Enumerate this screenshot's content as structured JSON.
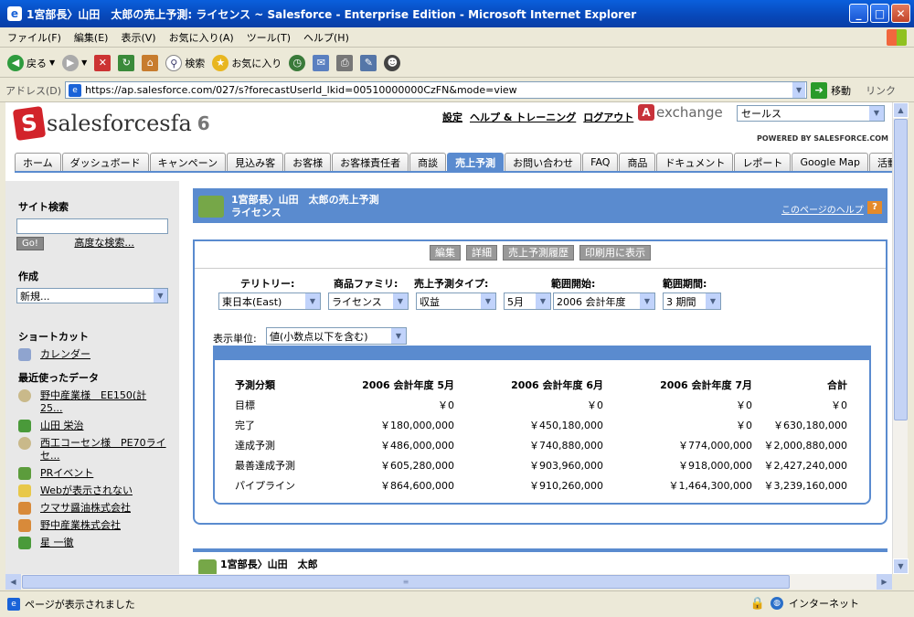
{
  "window": {
    "title": "1宮部長〉山田　太郎の売上予測: ライセンス ~ Salesforce - Enterprise Edition - Microsoft Internet Explorer"
  },
  "menu": [
    "ファイル(F)",
    "編集(E)",
    "表示(V)",
    "お気に入り(A)",
    "ツール(T)",
    "ヘルプ(H)"
  ],
  "toolbar": {
    "back": "戻る",
    "search": "検索",
    "favorites": "お気に入り"
  },
  "address": {
    "label": "アドレス(D)",
    "url": "https://ap.salesforce.com/027/s?forecastUserId_lkid=00510000000CzFN&mode=view",
    "go": "移動",
    "links": "リンク"
  },
  "sf": {
    "logo_text": "salesforcesfa",
    "logo_ver": "6",
    "top_links": [
      "設定",
      "ヘルプ & トレーニング",
      "ログアウト"
    ],
    "appexchange": "exchange",
    "app_select": "セールス",
    "powered": "POWERED BY SALESFORCE.COM",
    "tabs": [
      "ホーム",
      "ダッシュボード",
      "キャンペーン",
      "見込み客",
      "お客様",
      "お客様責任者",
      "商談",
      "売上予測",
      "お問い合わせ",
      "FAQ",
      "商品",
      "ドキュメント",
      "レポート",
      "Google Map",
      "活動予定/実"
    ]
  },
  "sidebar": {
    "search_title": "サイト検索",
    "go": "Go!",
    "advanced": "高度な検索...",
    "create_title": "作成",
    "create_value": "新規...",
    "shortcut_title": "ショートカット",
    "calendar": "カレンダー",
    "recent_title": "最近使ったデータ",
    "recent": [
      "野中産業様　EE150(計25...",
      "山田 栄治",
      "西工コーセン様　PE70ライセ...",
      "PRイベント",
      "Webが表示されない",
      "ウマサ醤油株式会社",
      "野中産業株式会社",
      "星 一徹"
    ]
  },
  "main": {
    "title_line1": "1宮部長〉山田　太郎の売上予測",
    "title_line2": "ライセンス",
    "help_link": "このページのヘルプ",
    "help_icon": "?",
    "buttons": [
      "編集",
      "詳細",
      "売上予測履歴",
      "印刷用に表示"
    ],
    "filters": {
      "territory_label": "テリトリー:",
      "territory": "東日本(East)",
      "family_label": "商品ファミリ:",
      "family": "ライセンス",
      "type_label": "売上予測タイプ:",
      "type": "収益",
      "start_label": "範囲開始:",
      "start_month": "5月",
      "start_year": "2006 会計年度",
      "period_label": "範囲期間:",
      "period": "3 期間"
    },
    "unit_label": "表示単位:",
    "unit_value": "値(小数点以下を含む)",
    "table": {
      "headers": [
        "予測分類",
        "2006 会計年度 5月",
        "2006 会計年度 6月",
        "2006 会計年度 7月",
        "合計"
      ],
      "rows": [
        [
          "目標",
          "￥0",
          "￥0",
          "￥0",
          "￥0"
        ],
        [
          "完了",
          "￥180,000,000",
          "￥450,180,000",
          "￥0",
          "￥630,180,000"
        ],
        [
          "達成予測",
          "￥486,000,000",
          "￥740,880,000",
          "￥774,000,000",
          "￥2,000,880,000"
        ],
        [
          "最善達成予測",
          "￥605,280,000",
          "￥903,960,000",
          "￥918,000,000",
          "￥2,427,240,000"
        ],
        [
          "パイプライン",
          "￥864,600,000",
          "￥910,260,000",
          "￥1,464,300,000",
          "￥3,239,160,000"
        ]
      ]
    },
    "section2_title": "1宮部長〉山田　太郎"
  },
  "status": {
    "text": "ページが表示されました",
    "zone": "インターネット"
  },
  "colors": {
    "accent": "#5a8bcf",
    "titlebar": "#0747b8"
  }
}
